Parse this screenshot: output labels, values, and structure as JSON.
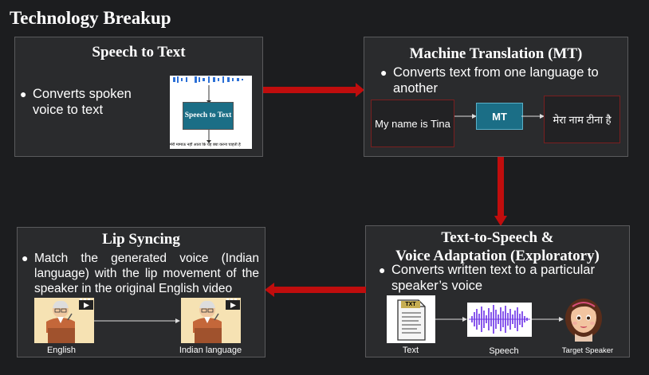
{
  "page_title": "Technology Breakup",
  "stt": {
    "title": "Speech to Text",
    "bullet": "Converts spoken voice to text",
    "image_label": "Speech to Text",
    "image_caption": "मेरी मामाऊ नहीं आता कि यह क्या करना चाहती है"
  },
  "mt": {
    "title": "Machine Translation (MT)",
    "bullet": "Converts text from one language to another",
    "source": "My name is Tina",
    "engine": "MT",
    "target": "मेरा नाम टीना है"
  },
  "tts": {
    "title_line1": "Text-to-Speech &",
    "title_line2": "Voice Adaptation (Exploratory)",
    "bullet": "Converts written text to a particular speaker’s voice",
    "txt_badge": "TXT",
    "captions": [
      "Text",
      "Speech",
      "Target Speaker"
    ]
  },
  "lip": {
    "title": "Lip Syncing",
    "bullet": "Match the generated voice (Indian language) with the lip movement of the speaker in the original English video",
    "captions": [
      "English",
      "Indian language"
    ]
  },
  "colors": {
    "arrow": "#c00d0d",
    "box_bg": "#2a2b2d",
    "mt_box": "#1b6e86"
  }
}
